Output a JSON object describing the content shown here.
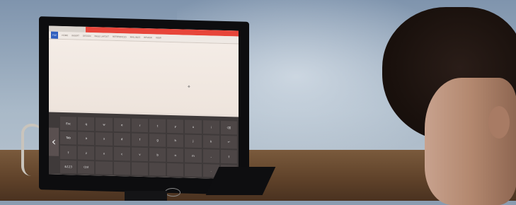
{
  "scene": {
    "description_hidden": ""
  },
  "monitor": {
    "app": {
      "title": "",
      "ribbon_tabs": [
        "FILE",
        "HOME",
        "INSERT",
        "DESIGN",
        "PAGE LAYOUT",
        "REFERENCES",
        "MAILINGS",
        "REVIEW",
        "VIEW"
      ]
    },
    "keyboard": {
      "keys": [
        "Esc",
        "q",
        "w",
        "e",
        "r",
        "t",
        "y",
        "u",
        "i",
        "⌫",
        "Tab",
        "a",
        "s",
        "d",
        "f",
        "g",
        "h",
        "j",
        "k",
        "↵",
        "⇧",
        "z",
        "x",
        "c",
        "v",
        "b",
        "n",
        "m",
        ",",
        "⇧",
        "&123",
        "Ctrl",
        "",
        "",
        "",
        "",
        "",
        "",
        ".",
        "⌨"
      ]
    }
  }
}
